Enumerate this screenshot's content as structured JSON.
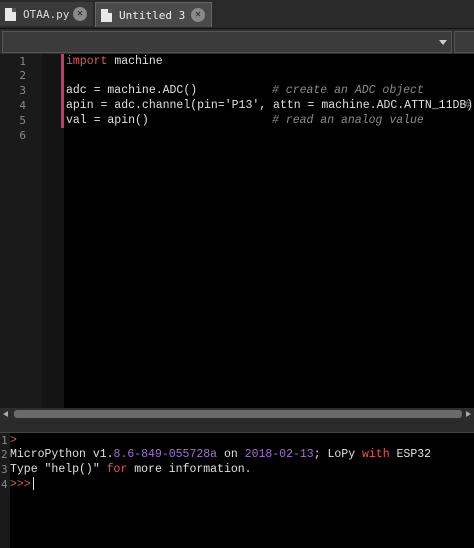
{
  "tabs": [
    {
      "label": "OTAA.py",
      "active": false
    },
    {
      "label": "Untitled 3",
      "active": true
    }
  ],
  "editor": {
    "line_numbers": [
      "1",
      "2",
      "3",
      "4",
      "5",
      "6"
    ],
    "line1": {
      "kw": "import",
      "rest": " machine"
    },
    "line3": {
      "code": "adc = machine.ADC()",
      "comment": "# create an ADC object"
    },
    "line4": {
      "code1": "apin = adc.channel(pin=",
      "str": "'P13'",
      "code2": ", attn = machine.ADC.ATTN_11DB)",
      "comment": "#"
    },
    "line5": {
      "code": "val = apin()",
      "comment": "# read an analog value"
    }
  },
  "console": {
    "line_numbers": [
      "1",
      "2",
      "3",
      "4"
    ],
    "line1": {
      "prompt": ">"
    },
    "line2": {
      "p1": "MicroPython v1.",
      "v1": "8.6-849-055728a",
      "p2": " on ",
      "date": "2018-02-13",
      "p3": "; LoPy ",
      "with": "with",
      "p4": " ESP32"
    },
    "line3": {
      "p1": "Type ",
      "help": "\"help()\"",
      "p2": " ",
      "for": "for",
      "p3": " more information."
    },
    "line4": {
      "prompt": ">>>"
    }
  },
  "colors": {
    "keyword": "#e05a5a",
    "comment": "#8a8a8a",
    "marker": "#d6336c",
    "number": "#a070d0"
  }
}
